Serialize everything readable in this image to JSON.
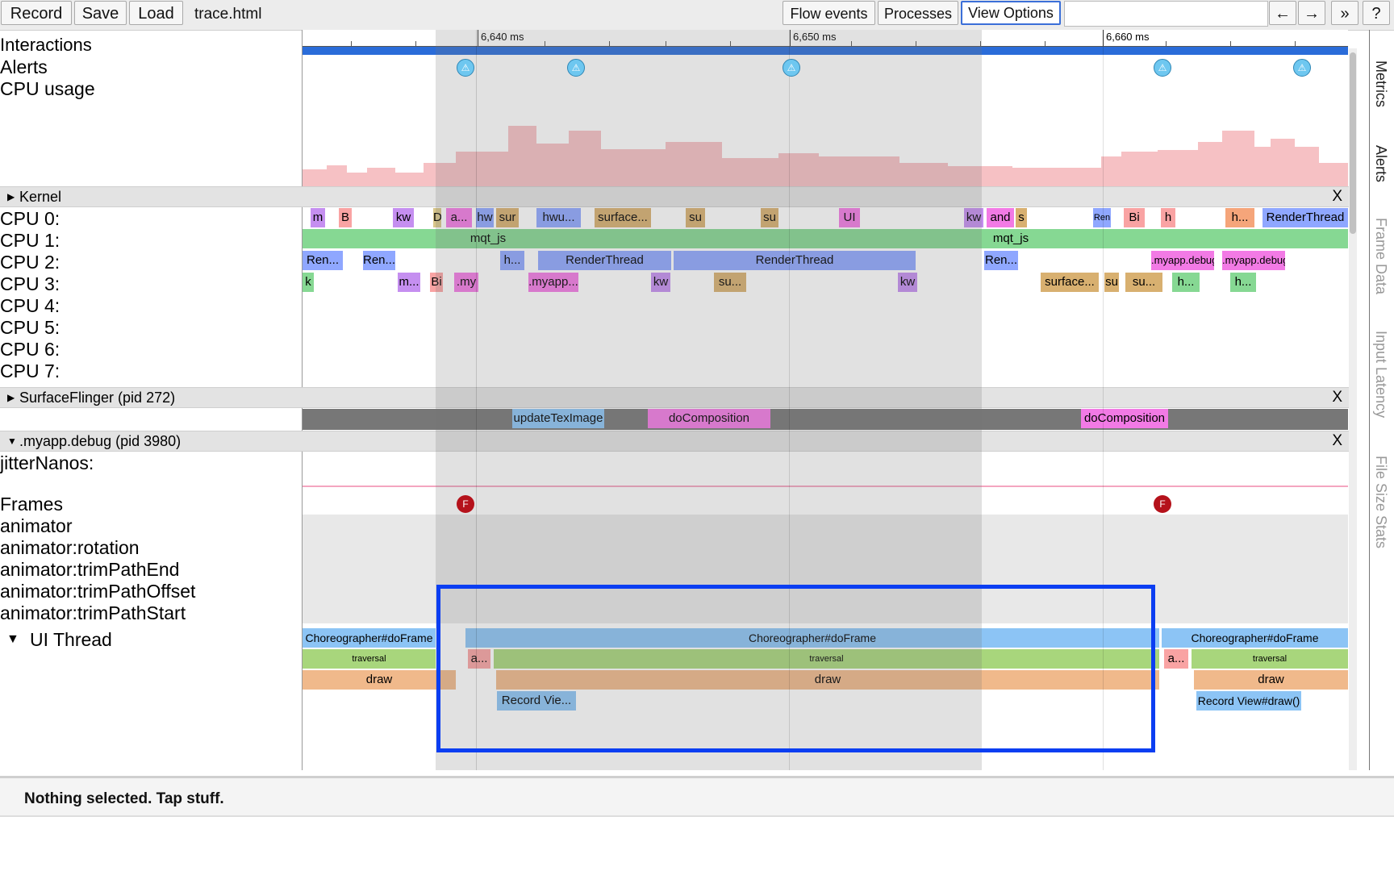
{
  "toolbar": {
    "record": "Record",
    "save": "Save",
    "load": "Load",
    "file_name": "trace.html",
    "flow_events": "Flow events",
    "processes": "Processes",
    "view_options": "View Options",
    "search_placeholder": "",
    "prev": "←",
    "next": "→",
    "more": "»",
    "help": "?"
  },
  "ruler": {
    "ticks": [
      "6,640 ms",
      "6,650 ms",
      "6,660 ms"
    ]
  },
  "tracks": {
    "interactions": "Interactions",
    "alerts": "Alerts",
    "cpu_usage": "CPU usage",
    "kernel_header": "Kernel",
    "cpus": [
      "CPU 0:",
      "CPU 1:",
      "CPU 2:",
      "CPU 3:",
      "CPU 4:",
      "CPU 5:",
      "CPU 6:",
      "CPU 7:"
    ],
    "surfaceflinger_header": "SurfaceFlinger (pid 272)",
    "app_header": ".myapp.debug (pid 3980)",
    "jitter": "jitterNanos:",
    "frames": "Frames",
    "animator": "animator",
    "animator_rotation": "animator:rotation",
    "animator_trimpathend": "animator:trimPathEnd",
    "animator_trimpathoffset": "animator:trimPathOffset",
    "animator_trimpathstart": "animator:trimPathStart",
    "ui_thread": "UI Thread",
    "close": "X"
  },
  "slices": {
    "sf_update": "updateTexImage",
    "sf_comp1": "doComposition",
    "sf_comp2": "doComposition",
    "choreo1": "Choreographer#doFrame",
    "choreo2": "Choreographer#doFrame",
    "choreo3": "Choreographer#doFrame",
    "traversal1": "traversal",
    "traversal2": "traversal",
    "traversal3": "traversal",
    "draw1": "draw",
    "draw2": "draw",
    "draw3": "draw",
    "anim2": "a...",
    "anim3": "a...",
    "record1": "Record Vie...",
    "record2": "Record View#draw()",
    "cpu0": [
      "m",
      "B",
      "kw",
      "D",
      "a...",
      "hw",
      "sur",
      "hwu...",
      "surface...",
      "su",
      "su",
      "UI",
      "kw",
      "and",
      "s",
      "Ren",
      "Bi",
      "h",
      "h...",
      "RenderThread"
    ],
    "cpu1": [
      "mqt_js",
      "mqt_js"
    ],
    "cpu2": [
      "Ren...",
      "Ren...",
      "h...",
      "RenderThread",
      "RenderThread",
      "Ren...",
      ".myapp.debug",
      ".myapp.debug"
    ],
    "cpu3": [
      "k",
      "m...",
      "Bi",
      ".my",
      ".myapp...",
      "kw",
      "su...",
      "kw",
      "surface...",
      "su",
      "su...",
      "h...",
      "h..."
    ]
  },
  "markers": {
    "alert_glyph": "⚠",
    "frame_glyph": "F"
  },
  "side_tabs": [
    "Metrics",
    "Alerts",
    "Frame Data",
    "Input Latency",
    "File Size Stats"
  ],
  "status": "Nothing selected. Tap stuff."
}
